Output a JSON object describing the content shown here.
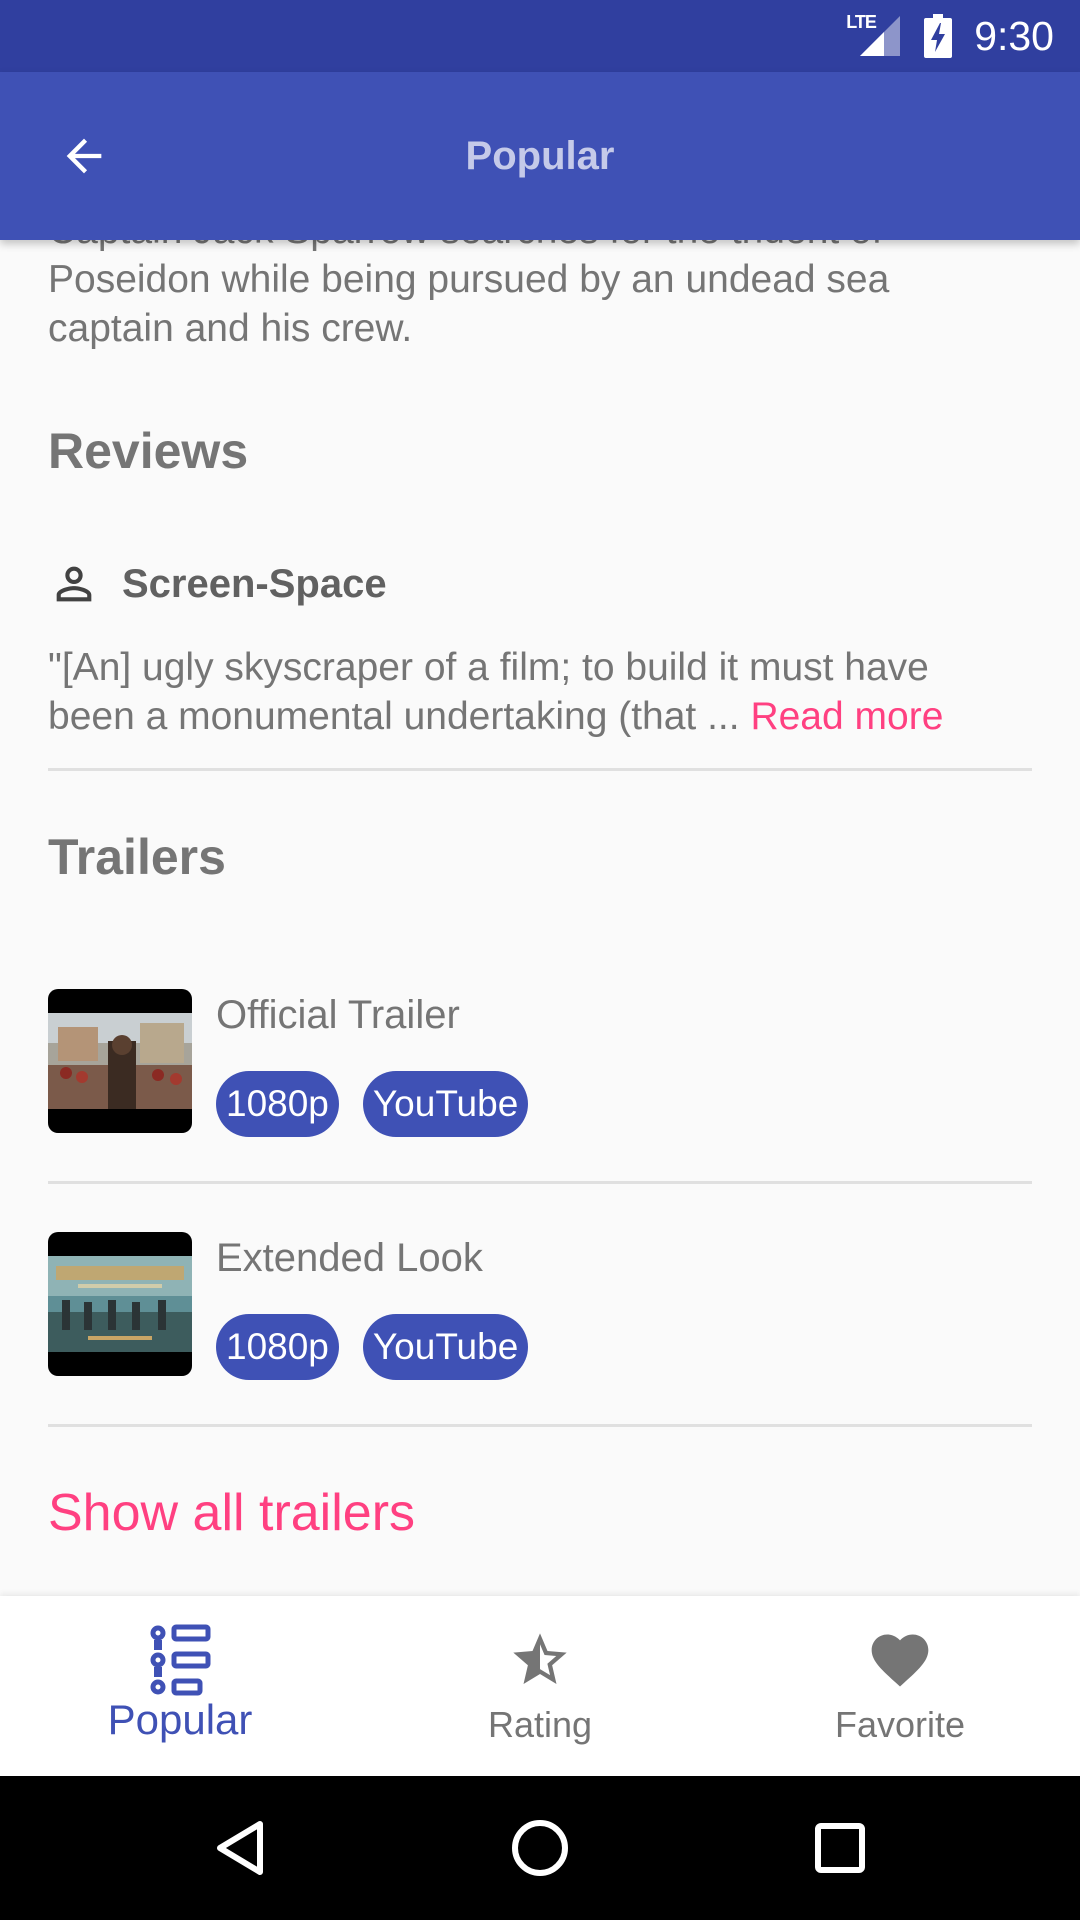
{
  "status_bar": {
    "network_label": "LTE",
    "time": "9:30"
  },
  "app_bar": {
    "title": "Popular",
    "back_icon": "arrow-back-icon"
  },
  "movie": {
    "overview_lines": [
      "Captain Jack Sparrow searches for the trident of",
      "Poseidon while being pursued by an undead sea",
      "captain and his crew."
    ]
  },
  "reviews": {
    "heading": "Reviews",
    "items": [
      {
        "author": "Screen-Space",
        "author_icon": "person-icon",
        "excerpt_line1": "\"[An] ugly skyscraper of a film; to build it must have",
        "excerpt_line2": "been a monumental undertaking (that ... ",
        "read_more": "Read more"
      }
    ]
  },
  "trailers": {
    "heading": "Trailers",
    "items": [
      {
        "name": "Official Trailer",
        "quality": "1080p",
        "site": "YouTube"
      },
      {
        "name": "Extended Look",
        "quality": "1080p",
        "site": "YouTube"
      }
    ],
    "show_all": "Show all trailers"
  },
  "bottom_nav": {
    "items": [
      {
        "label": "Popular",
        "icon": "list-icon",
        "active": true
      },
      {
        "label": "Rating",
        "icon": "star-icon",
        "active": false
      },
      {
        "label": "Favorite",
        "icon": "heart-icon",
        "active": false
      }
    ]
  },
  "colors": {
    "primary": "#3f51b5",
    "primary_dark": "#303f9f",
    "accent": "#ff4081",
    "text_secondary": "#757575"
  }
}
